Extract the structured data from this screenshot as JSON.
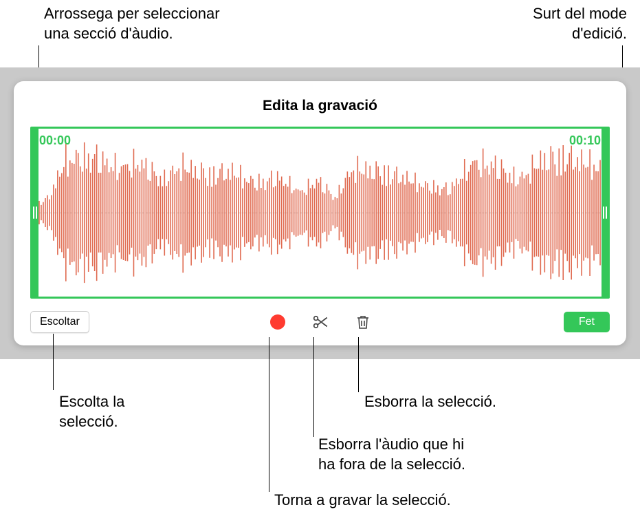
{
  "callouts": {
    "drag_select": "Arrossega per seleccionar\nuna secció d'àudio.",
    "exit_edit": "Surt del mode\nd'edició.",
    "listen_selection": "Escolta la\nselecció.",
    "delete_selection": "Esborra la selecció.",
    "trim_outside": "Esborra l'àudio que hi\nha fora de la selecció.",
    "rerecord": "Torna a gravar la selecció."
  },
  "panel": {
    "title": "Edita la gravació",
    "time_start": "00:00",
    "time_end": "00:10"
  },
  "toolbar": {
    "listen_label": "Escoltar",
    "done_label": "Fet"
  }
}
